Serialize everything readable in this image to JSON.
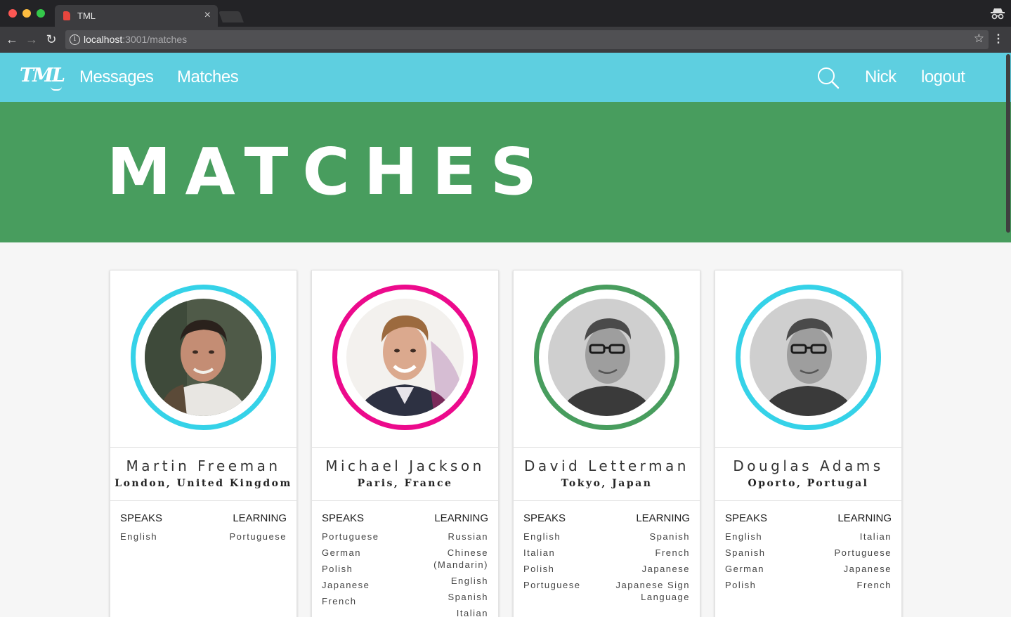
{
  "browser": {
    "tab_title": "TML",
    "tab_close": "×",
    "url_host": "localhost",
    "url_rest": ":3001/matches"
  },
  "nav": {
    "logo": "TML",
    "links": [
      "Messages",
      "Matches"
    ],
    "user": "Nick",
    "logout": "logout"
  },
  "hero": {
    "title": "MATCHES"
  },
  "cards": [
    {
      "name": "Martin Freeman",
      "location": "London, United Kingdom",
      "ring_color": "#35d2e8",
      "speaks_label": "SPEAKS",
      "learning_label": "LEARNING",
      "speaks": [
        "English"
      ],
      "learning": [
        "Portuguese"
      ]
    },
    {
      "name": "Michael Jackson",
      "location": "Paris, France",
      "ring_color": "#ec0a8c",
      "speaks_label": "SPEAKS",
      "learning_label": "LEARNING",
      "speaks": [
        "Portuguese",
        "German",
        "Polish",
        "Japanese",
        "French"
      ],
      "learning": [
        "Russian",
        "Chinese (Mandarin)",
        "English",
        "Spanish",
        "Italian"
      ]
    },
    {
      "name": "David Letterman",
      "location": "Tokyo, Japan",
      "ring_color": "#489d5e",
      "speaks_label": "SPEAKS",
      "learning_label": "LEARNING",
      "speaks": [
        "English",
        "Italian",
        "Polish",
        "Portuguese"
      ],
      "learning": [
        "Spanish",
        "French",
        "Japanese",
        "Japanese Sign Language"
      ]
    },
    {
      "name": "Douglas Adams",
      "location": "Oporto, Portugal",
      "ring_color": "#35d2e8",
      "speaks_label": "SPEAKS",
      "learning_label": "LEARNING",
      "speaks": [
        "English",
        "Spanish",
        "German",
        "Polish"
      ],
      "learning": [
        "Italian",
        "Portuguese",
        "Japanese",
        "French"
      ]
    }
  ],
  "colors": {
    "navbar": "#5ecfe0",
    "hero": "#489d5e",
    "page_bg": "#f6f6f6"
  }
}
